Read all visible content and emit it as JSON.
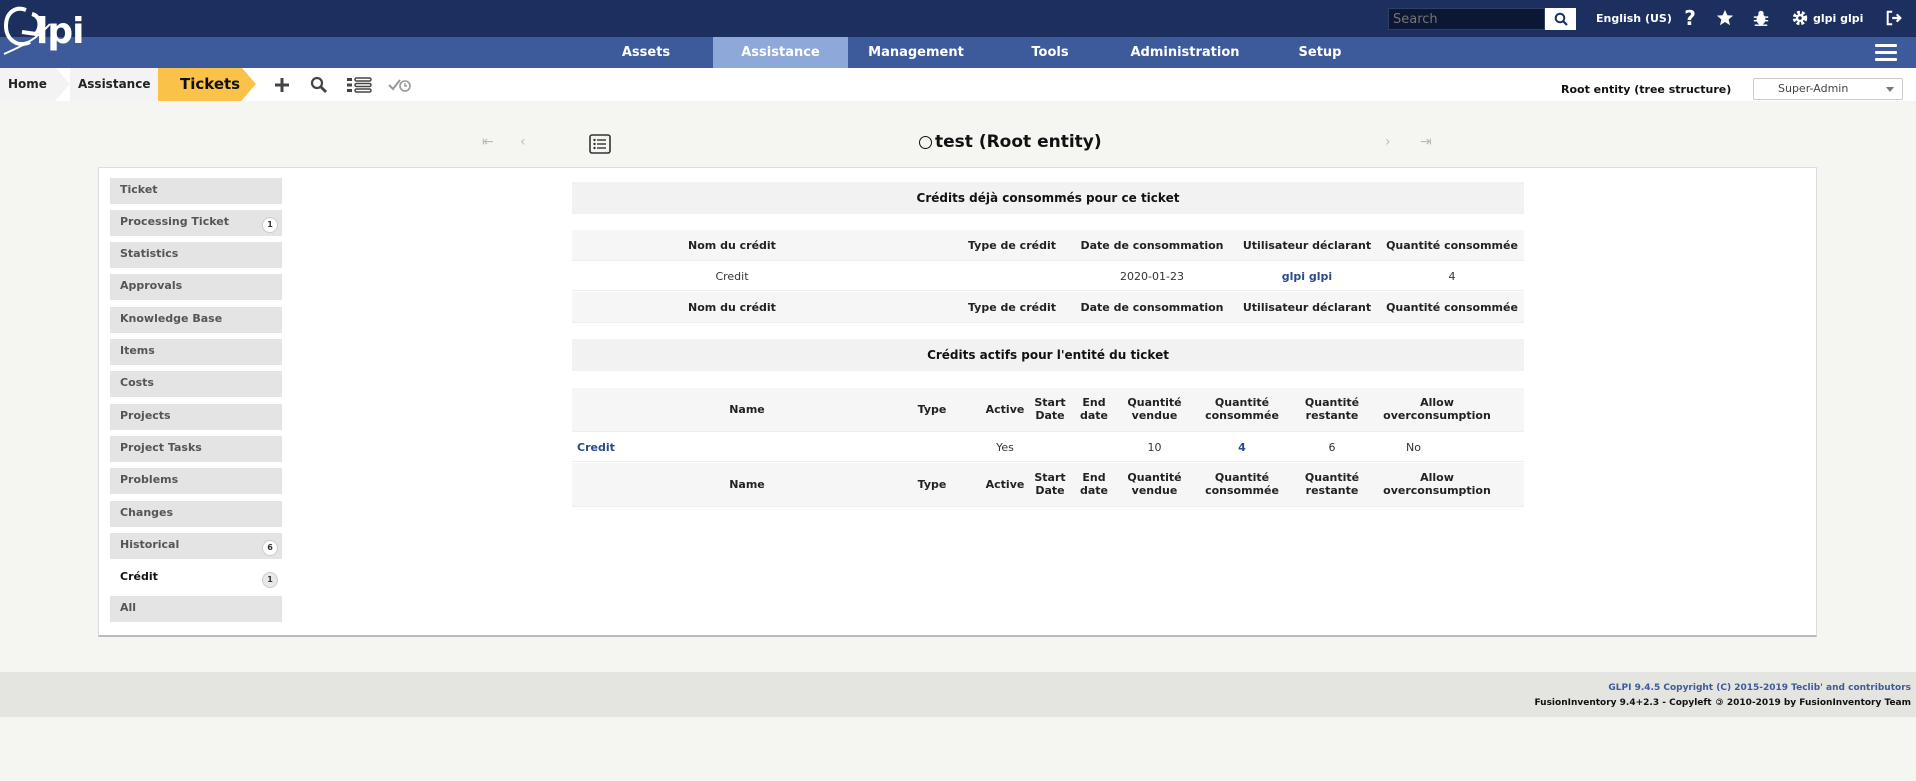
{
  "header": {
    "logo_text": "Glpi",
    "search_placeholder": "Search",
    "language": "English (US)",
    "user": "glpi glpi"
  },
  "menu": [
    {
      "label": "Assets"
    },
    {
      "label": "Assistance"
    },
    {
      "label": "Management"
    },
    {
      "label": "Tools"
    },
    {
      "label": "Administration"
    },
    {
      "label": "Setup"
    }
  ],
  "breadcrumb": {
    "home": "Home",
    "section": "Assistance",
    "current": "Tickets"
  },
  "entity": {
    "label": "Root entity (tree structure)",
    "profile": "Super-Admin"
  },
  "record": {
    "title": "test (Root entity)"
  },
  "tabs": [
    {
      "label": "Ticket",
      "count": ""
    },
    {
      "label": "Processing Ticket",
      "count": "1"
    },
    {
      "label": "Statistics",
      "count": ""
    },
    {
      "label": "Approvals",
      "count": ""
    },
    {
      "label": "Knowledge Base",
      "count": ""
    },
    {
      "label": "Items",
      "count": ""
    },
    {
      "label": "Costs",
      "count": ""
    },
    {
      "label": "Projects",
      "count": ""
    },
    {
      "label": "Project Tasks",
      "count": ""
    },
    {
      "label": "Problems",
      "count": ""
    },
    {
      "label": "Changes",
      "count": ""
    },
    {
      "label": "Historical",
      "count": "6"
    },
    {
      "label": "Crédit",
      "count": "1"
    },
    {
      "label": "All",
      "count": ""
    }
  ],
  "consumed": {
    "title": "Crédits déjà consommés pour ce ticket",
    "columns": [
      "Nom du crédit",
      "Type de crédit",
      "Date de consommation",
      "Utilisateur déclarant",
      "Quantité consommée"
    ],
    "rows": [
      {
        "name": "Credit",
        "type": "",
        "date": "2020-01-23",
        "user": "glpi glpi",
        "quantity": "4"
      }
    ]
  },
  "active": {
    "title": "Crédits actifs pour l'entité du ticket",
    "columns": {
      "name": "Name",
      "type": "Type",
      "active": "Active",
      "start": "Start Date",
      "end": "End date",
      "sold": "Quantité vendue",
      "consumed": "Quantité consommée",
      "remaining": "Quantité restante",
      "overconsumption": "Allow overconsumption"
    },
    "rows": [
      {
        "name": "Credit",
        "type": "",
        "active": "Yes",
        "start": "",
        "end": "",
        "sold": "10",
        "consumed": "4",
        "remaining": "6",
        "overconsumption": "No"
      }
    ]
  },
  "footer": {
    "copyright": "GLPI 9.4.5 Copyright (C) 2015-2019 Teclib' and contributors",
    "fusion_prefix": "FusionInventory 9.4+2.3 - Copyleft",
    "fusion_suffix": "2010-2019 by FusionInventory Team"
  },
  "colors": {
    "topbar": "#1d2f5f",
    "menubar": "#3d5a9a",
    "menu_active": "#8fa8da",
    "current_crumb": "#fbc24a"
  }
}
